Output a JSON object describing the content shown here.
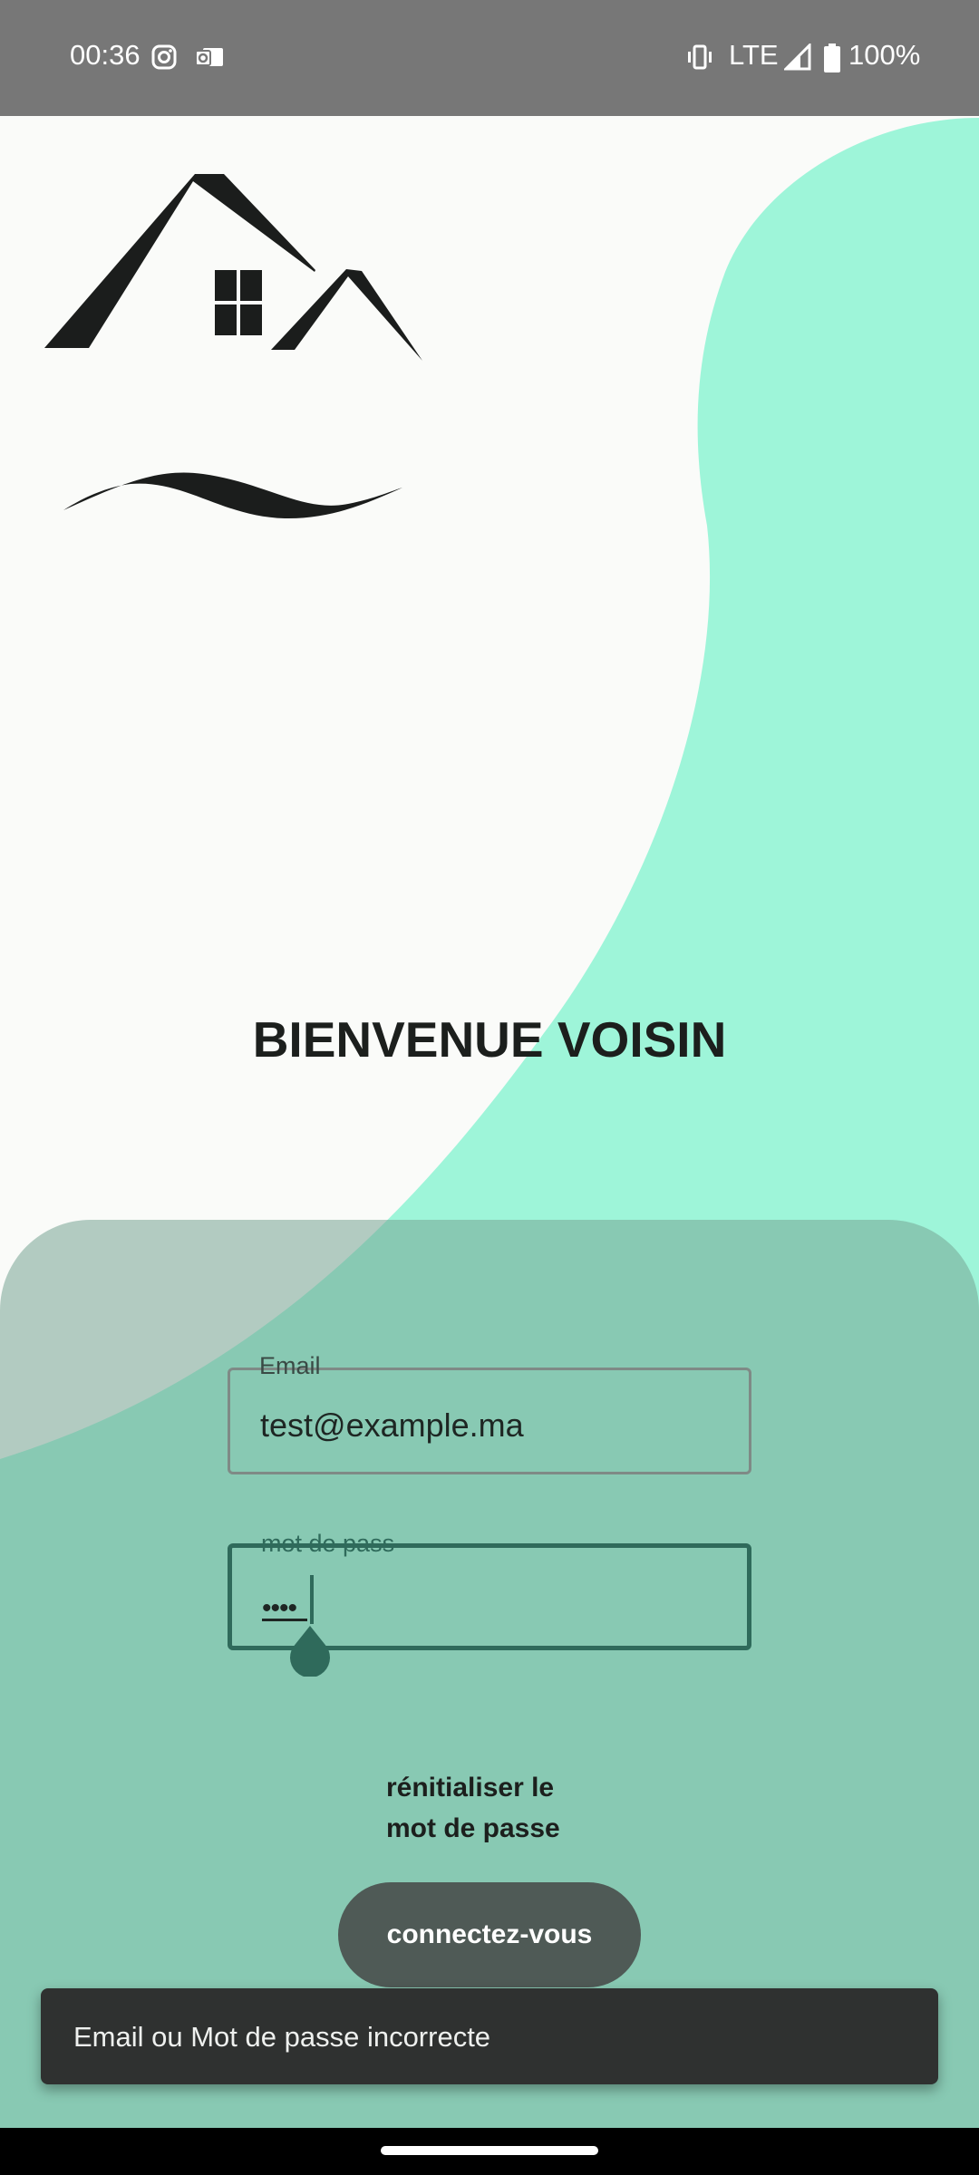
{
  "status_bar": {
    "time": "00:36",
    "network": "LTE",
    "battery": "100%",
    "icons": [
      "instagram-icon",
      "outlook-icon",
      "vibrate-icon",
      "signal-icon",
      "battery-icon"
    ]
  },
  "welcome_title": "BIENVENUE VOISIN",
  "form": {
    "email_label": "Email",
    "email_value": "test@example.ma",
    "password_label": "mot de pass",
    "password_value": "••••"
  },
  "reset_link": {
    "line1": "rénitialiser le",
    "line2": "mot de passe"
  },
  "login_button": "connectez-vous",
  "snackbar": "Email ou Mot de passe incorrecte",
  "colors": {
    "accent_mint": "#9ef5d9",
    "card_green": "#7bc4ac",
    "primary_dark_green": "#2f6a5b",
    "button": "#4f5a56",
    "status_bar": "#777777"
  }
}
